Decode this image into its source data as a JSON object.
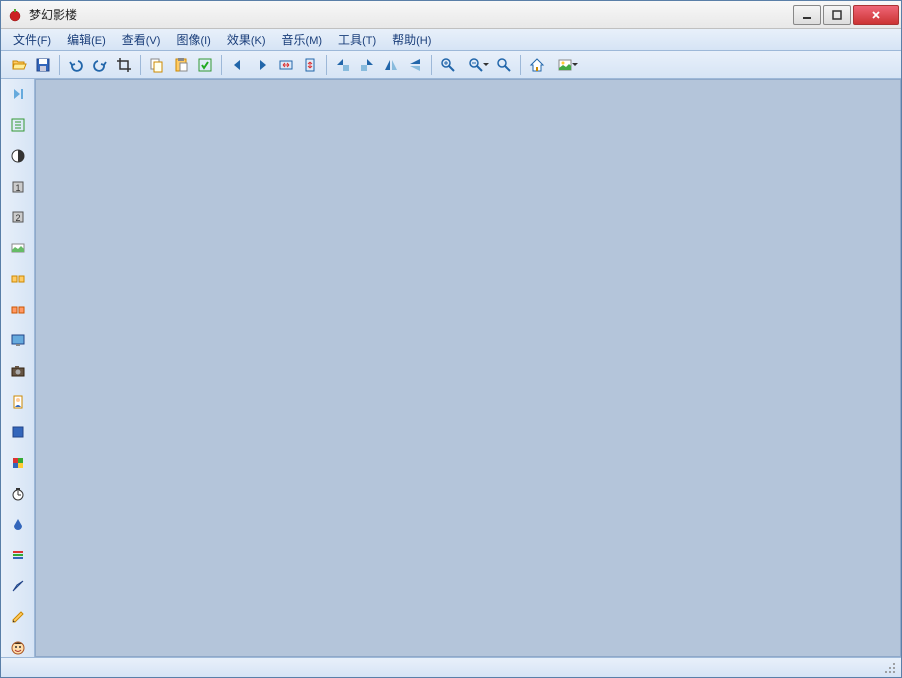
{
  "window": {
    "title": "梦幻影楼"
  },
  "menus": [
    {
      "label": "文件",
      "key": "(F)"
    },
    {
      "label": "编辑",
      "key": "(E)"
    },
    {
      "label": "查看",
      "key": "(V)"
    },
    {
      "label": "图像",
      "key": "(I)"
    },
    {
      "label": "效果",
      "key": "(K)"
    },
    {
      "label": "音乐",
      "key": "(M)"
    },
    {
      "label": "工具",
      "key": "(T)"
    },
    {
      "label": "帮助",
      "key": "(H)"
    }
  ],
  "toolbar_icons": {
    "open": "open-icon",
    "save": "save-icon",
    "undo": "undo-icon",
    "redo": "redo-icon",
    "crop": "crop-icon",
    "copy": "copy-icon",
    "paste": "paste-icon",
    "apply": "apply-icon",
    "prev": "prev-icon",
    "next": "next-icon",
    "fit_w": "fit-width-icon",
    "fit_h": "fit-height-icon",
    "rotate_left": "rotate-left-icon",
    "rotate_right": "rotate-right-icon",
    "flip_h": "flip-h-icon",
    "flip_v": "flip-v-icon",
    "zoom_in": "zoom-in-icon",
    "zoom_out": "zoom-out-icon",
    "zoom_fit": "zoom-fit-icon",
    "home": "home-icon",
    "picture": "picture-icon"
  },
  "sidebar_icons": {
    "forward": "forward-end-icon",
    "adjust": "adjust-icon",
    "contrast": "contrast-icon",
    "one": "one-icon",
    "two": "two-icon",
    "image_small": "image-small-icon",
    "hsplit": "hsplit-icon",
    "hsplit2": "hsplit2-icon",
    "screen": "screen-icon",
    "camera": "camera-icon",
    "portrait": "portrait-icon",
    "color_a": "color-a-icon",
    "color_b": "color-b-icon",
    "timer": "timer-icon",
    "drop": "drop-icon",
    "lines": "lines-icon",
    "feather": "feather-icon",
    "pencil": "pencil-icon",
    "face": "face-icon"
  }
}
